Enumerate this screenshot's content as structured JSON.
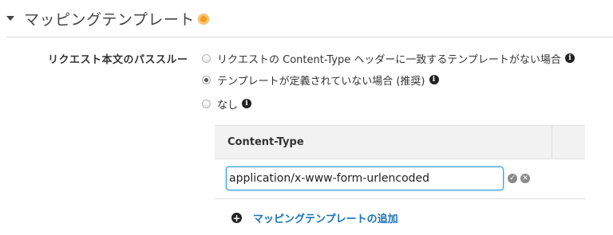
{
  "section": {
    "title": "マッピングテンプレート"
  },
  "passthrough": {
    "label": "リクエスト本文のパススルー",
    "options": [
      {
        "label": "リクエストの Content-Type ヘッダーに一致するテンプレートがない場合",
        "checked": false
      },
      {
        "label": "テンプレートが定義されていない場合 (推奨)",
        "checked": true
      },
      {
        "label": "なし",
        "checked": false
      }
    ]
  },
  "content_type_table": {
    "header": "Content-Type",
    "input_value": "application/x-www-form-urlencoded"
  },
  "add_template": {
    "label": "マッピングテンプレートの追加"
  },
  "colors": {
    "accent_orange": "#f79b1e",
    "link_blue": "#1a73b5",
    "focus_blue": "#2e9fd8"
  }
}
